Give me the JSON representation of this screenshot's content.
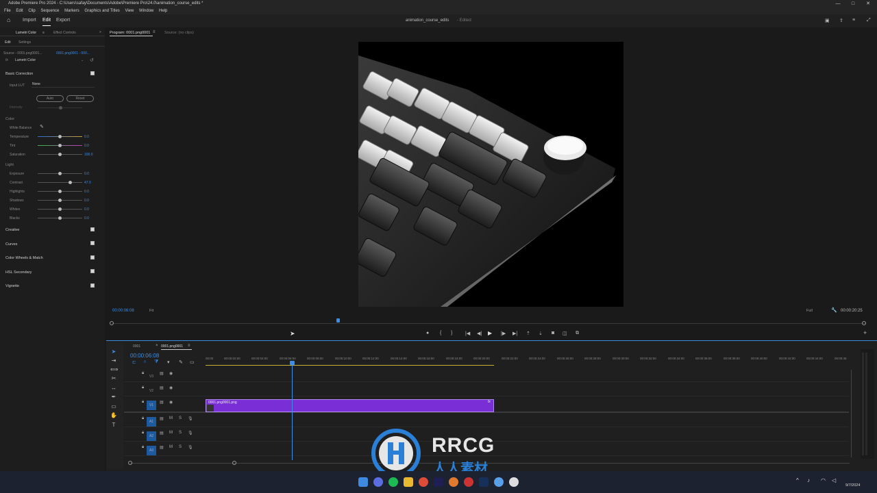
{
  "window": {
    "title": "Adobe Premiere Pro 2024 - C:\\Users\\safay\\Documents\\Adobe\\Premiere Pro\\24.0\\animation_course_edits *"
  },
  "menu": [
    "File",
    "Edit",
    "Clip",
    "Sequence",
    "Markers",
    "Graphics and Titles",
    "View",
    "Window",
    "Help"
  ],
  "workspace": {
    "import": "Import",
    "edit": "Edit",
    "export": "Export",
    "project": "animation_course_edits",
    "status": "- Edited"
  },
  "left_panel": {
    "tab_lumetri": "Lumetri Color",
    "tab_effect": "Effect Controls",
    "sub_edit": "Edit",
    "sub_settings": "Settings",
    "source": "Source - 0001.png0001...",
    "target": "0001.png0001 - 000...",
    "fx": "fx",
    "effect_name": "Lumetri Color",
    "basic": "Basic Correction",
    "input_lut": "Input LUT",
    "input_lut_val": "None",
    "auto": "Auto",
    "reset": "Reset",
    "intensity": "Intensity",
    "color": "Color",
    "white_balance": "White Balance",
    "temperature": "Temperature",
    "temperature_val": "0.0",
    "tint": "Tint",
    "tint_val": "0.0",
    "saturation": "Saturation",
    "saturation_val": "100.0",
    "light": "Light",
    "exposure": "Exposure",
    "exposure_val": "0.0",
    "contrast": "Contrast",
    "contrast_val": "47.0",
    "highlights": "Highlights",
    "highlights_val": "0.0",
    "shadows": "Shadows",
    "shadows_val": "0.0",
    "whites": "Whites",
    "whites_val": "0.0",
    "blacks": "Blacks",
    "blacks_val": "0.0",
    "creative": "Creative",
    "curves": "Curves",
    "wheels": "Color Wheels & Match",
    "hsl": "HSL Secondary",
    "vignette": "Vignette"
  },
  "program": {
    "tab": "Program: 0001.png0001",
    "source_tab": "Source: (no clips)",
    "timecode": "00:00:06:08",
    "fit": "Fit",
    "quality": "Full",
    "duration": "00:00:20:25"
  },
  "timeline": {
    "tab1": "0001",
    "tab2": "0001.png0001",
    "timecode": "00:00:06:08",
    "ruler": [
      "00:00",
      "00:00:02:00",
      "00:00:04:00",
      "00:00:06:00",
      "00:00:08:00",
      "00:00:10:00",
      "00:00:12:00",
      "00:00:14:00",
      "00:00:16:00",
      "00:00:18:00",
      "00:00:20:00",
      "00:00:22:00",
      "00:00:24:00",
      "00:00:26:00",
      "00:00:28:00",
      "00:00:30:00",
      "00:00:32:00",
      "00:00:34:00",
      "00:00:36:00",
      "00:00:38:00",
      "00:00:40:00",
      "00:00:42:00",
      "00:00:44:00",
      "00:00:46"
    ],
    "tracks": [
      "V3",
      "V2",
      "V1",
      "A1",
      "A2",
      "A3"
    ],
    "clip": "0001.png0001.png",
    "clip_fx": "fx"
  },
  "watermark": {
    "brand": "RRCG",
    "sub": "人人素材"
  },
  "taskbar": {
    "date": "9/7/2024"
  },
  "colors": {
    "accent": "#3b8ee8",
    "clip": "#7a2fd6",
    "panel": "#1d1d1d"
  }
}
